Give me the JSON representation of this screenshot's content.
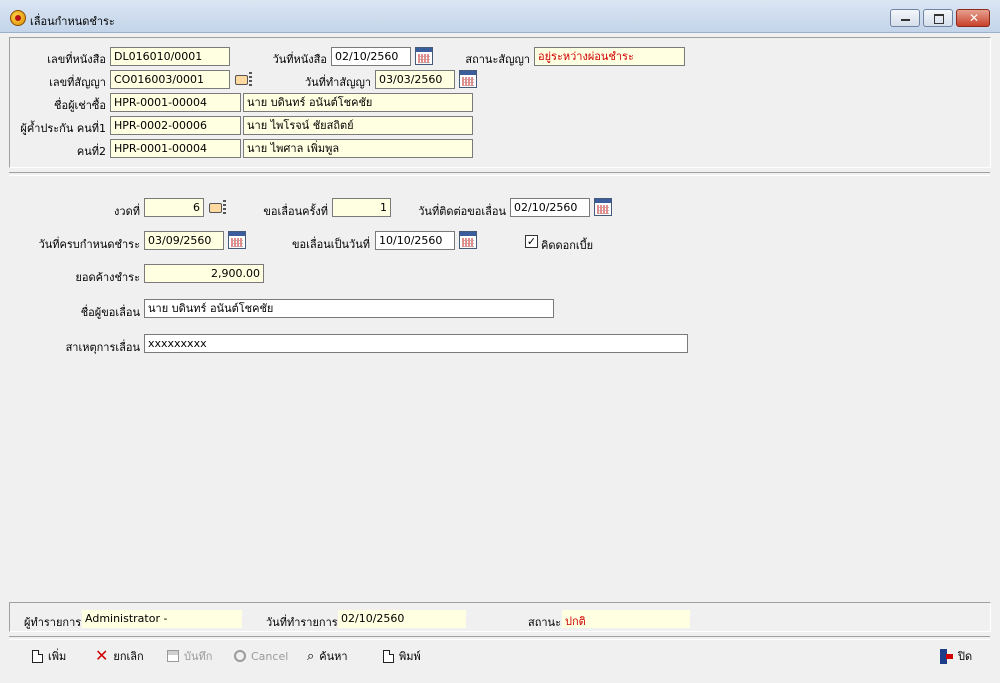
{
  "window": {
    "title": "เลื่อนกำหนดชำระ"
  },
  "header": {
    "doc_no_label": "เลขที่หนังสือ",
    "doc_no": "DL016010/0001",
    "doc_date_label": "วันที่หนังสือ",
    "doc_date": "02/10/2560",
    "contract_status_label": "สถานะสัญญา",
    "contract_status": "อยู่ระหว่างผ่อนชำระ",
    "contract_no_label": "เลขที่สัญญา",
    "contract_no": "CO016003/0001",
    "contract_date_label": "วันที่ทำสัญญา",
    "contract_date": "03/03/2560",
    "buyer_label": "ชื่อผู้เช่าซื้อ",
    "buyer_code": "HPR-0001-00004",
    "buyer_name": "นาย บดินทร์ อนันต์โชคชัย",
    "guarantor1_label": "ผู้ค้ำประกัน คนที่1",
    "guarantor1_code": "HPR-0002-00006",
    "guarantor1_name": "นาย ไพโรจน์ ชัยสถิตย์",
    "guarantor2_label": "คนที่2",
    "guarantor2_code": "HPR-0001-00004",
    "guarantor2_name": "นาย ไพศาล เพิ่มพูล"
  },
  "detail": {
    "installment_label": "งวดที่",
    "installment": "6",
    "request_count_label": "ขอเลื่อนครั้งที่",
    "request_count": "1",
    "contact_date_label": "วันที่ติดต่อขอเลื่อน",
    "contact_date": "02/10/2560",
    "due_date_label": "วันที่ครบกำหนดชำระ",
    "due_date": "03/09/2560",
    "postpone_to_label": "ขอเลื่อนเป็นวันที่",
    "postpone_to": "10/10/2560",
    "charge_interest_label": "คิดดอกเบี้ย",
    "charge_interest_checked": true,
    "check_mark": "✓",
    "outstanding_label": "ยอดค้างชำระ",
    "outstanding": "2,900.00",
    "requester_label": "ชื่อผู้ขอเลื่อน",
    "requester": "นาย บดินทร์ อนันต์โชคชัย",
    "reason_label": "สาเหตุการเลื่อน",
    "reason": "xxxxxxxxx"
  },
  "status_bar": {
    "operator_label": "ผู้ทำรายการ",
    "operator": "Administrator -",
    "txn_date_label": "วันที่ทำรายการ",
    "txn_date": "02/10/2560",
    "status_label": "สถานะ",
    "status": "ปกติ"
  },
  "toolbar": {
    "add_label": "เพิ่ม",
    "cancel_edit_label": "ยกเลิก",
    "save_label": "บันทึก",
    "cancel_label": "Cancel",
    "search_label": "ค้นหา",
    "print_label": "พิมพ์",
    "close_label": "ปิด"
  },
  "colors": {
    "input_bg": "#ffffe1",
    "status_red": "#d00000"
  }
}
